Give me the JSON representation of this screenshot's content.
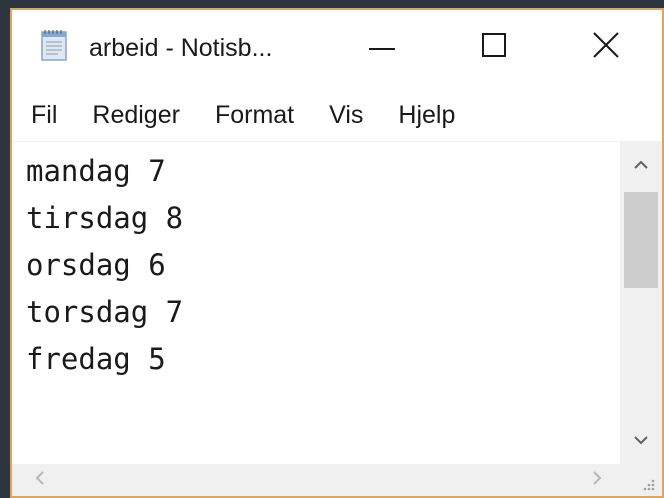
{
  "window": {
    "title": "arbeid - Notisb...",
    "icon": "notepad-icon"
  },
  "titlebar_buttons": {
    "minimize_icon": "minimize-icon",
    "maximize_icon": "maximize-icon",
    "close_icon": "close-icon"
  },
  "menu": {
    "items": [
      {
        "label": "Fil"
      },
      {
        "label": "Rediger"
      },
      {
        "label": "Format"
      },
      {
        "label": "Vis"
      },
      {
        "label": "Hjelp"
      }
    ]
  },
  "editor": {
    "lines": [
      "mandag 7",
      "tirsdag 8",
      "orsdag 6",
      "torsdag 7",
      "fredag 5"
    ]
  },
  "colors": {
    "window_border": "#e0a55a",
    "desktop": "#2d3640",
    "scrollbar_track": "#f0f0f0",
    "scrollbar_thumb": "#cdcdcd"
  }
}
